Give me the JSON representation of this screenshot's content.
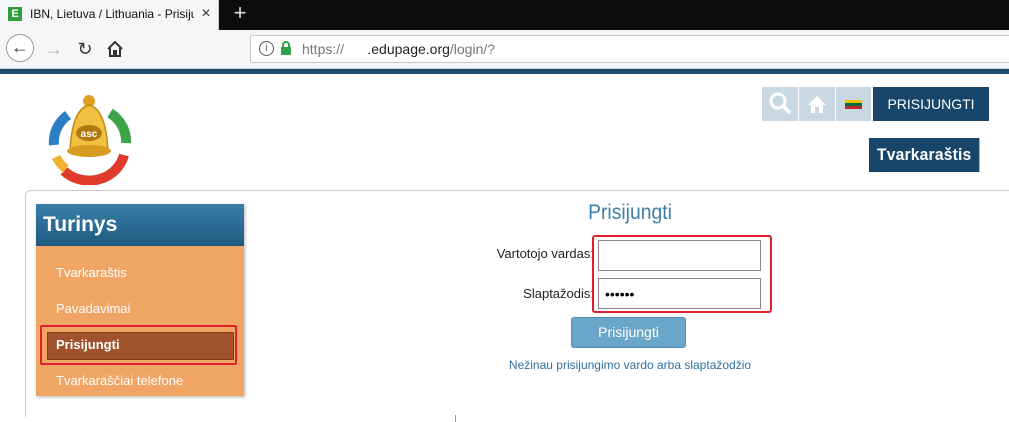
{
  "browser": {
    "tab_title": "IBN, Lietuva / Lithuania - Prisiju",
    "favicon_letter": "E",
    "url": {
      "protocol": "https://",
      "domain": "      .edupage.org",
      "path": "/login/?"
    }
  },
  "header": {
    "login_button": "PRISIJUNGTI",
    "timetable_button": "Tvarkaraštis",
    "logo_text": "asc"
  },
  "sidebar": {
    "title": "Turinys",
    "items": [
      {
        "label": "Tvarkaraštis"
      },
      {
        "label": "Pavadavimai"
      },
      {
        "label": "Prisijungti"
      },
      {
        "label": "Tvarkaraščiai telefone"
      }
    ]
  },
  "login_form": {
    "title": "Prisijungti",
    "username_label": "Vartotojo vardas:",
    "username_value": "",
    "password_label": "Slaptažodis:",
    "password_value": "••••••",
    "submit_label": "Prisijungti",
    "forgot_link": "Nežinau prisijungimo vardo arba slaptažodžio"
  },
  "colors": {
    "accent_dark": "#17466a",
    "sidebar_bg": "#f0a565",
    "highlight": "#e0202a"
  }
}
